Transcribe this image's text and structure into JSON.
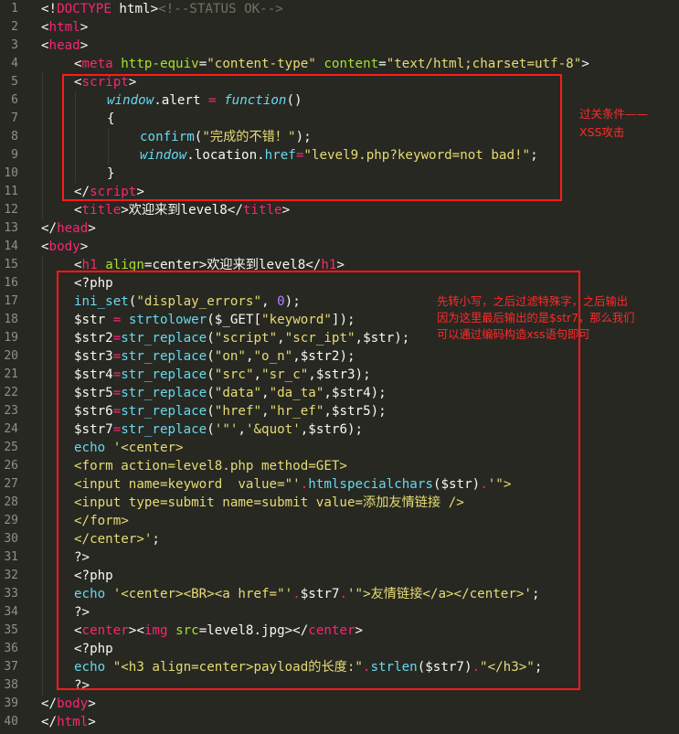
{
  "lines": [
    {
      "n": "1",
      "indent": 0,
      "tokens": [
        {
          "t": "<!",
          "c": "pl"
        },
        {
          "t": "DOCTYPE",
          "c": "tg"
        },
        {
          "t": " html>",
          "c": "pl"
        },
        {
          "t": "<!--STATUS OK-->",
          "c": "cm"
        }
      ]
    },
    {
      "n": "2",
      "indent": 0,
      "tokens": [
        {
          "t": "<",
          "c": "pl"
        },
        {
          "t": "html",
          "c": "tg"
        },
        {
          "t": ">",
          "c": "pl"
        }
      ]
    },
    {
      "n": "3",
      "indent": 0,
      "tokens": [
        {
          "t": "<",
          "c": "pl"
        },
        {
          "t": "head",
          "c": "tg"
        },
        {
          "t": ">",
          "c": "pl"
        }
      ]
    },
    {
      "n": "4",
      "indent": 1,
      "tokens": [
        {
          "t": "<",
          "c": "pl"
        },
        {
          "t": "meta",
          "c": "tg"
        },
        {
          "t": " ",
          "c": "pl"
        },
        {
          "t": "http-equiv",
          "c": "at"
        },
        {
          "t": "=",
          "c": "pl"
        },
        {
          "t": "\"content-type\"",
          "c": "st"
        },
        {
          "t": " ",
          "c": "pl"
        },
        {
          "t": "content",
          "c": "at"
        },
        {
          "t": "=",
          "c": "pl"
        },
        {
          "t": "\"text/html;charset=utf-8\"",
          "c": "st"
        },
        {
          "t": ">",
          "c": "pl"
        }
      ]
    },
    {
      "n": "5",
      "indent": 1,
      "tokens": [
        {
          "t": "<",
          "c": "pl"
        },
        {
          "t": "script",
          "c": "tg"
        },
        {
          "t": ">",
          "c": "pl"
        }
      ]
    },
    {
      "n": "6",
      "indent": 2,
      "tokens": [
        {
          "t": "window",
          "c": "fn"
        },
        {
          "t": ".alert ",
          "c": "pl"
        },
        {
          "t": "=",
          "c": "kw"
        },
        {
          "t": " ",
          "c": "pl"
        },
        {
          "t": "function",
          "c": "fn"
        },
        {
          "t": "()",
          "c": "pl"
        }
      ]
    },
    {
      "n": "7",
      "indent": 2,
      "tokens": [
        {
          "t": "{",
          "c": "pl"
        }
      ]
    },
    {
      "n": "8",
      "indent": 3,
      "tokens": [
        {
          "t": "confirm",
          "c": "bf"
        },
        {
          "t": "(",
          "c": "pl"
        },
        {
          "t": "\"完成的不错！\"",
          "c": "st"
        },
        {
          "t": ");",
          "c": "pl"
        }
      ]
    },
    {
      "n": "9",
      "indent": 3,
      "tokens": [
        {
          "t": "window",
          "c": "fn"
        },
        {
          "t": ".location.",
          "c": "pl"
        },
        {
          "t": "href",
          "c": "bf"
        },
        {
          "t": "=",
          "c": "kw"
        },
        {
          "t": "\"level9.php?keyword=not bad!\"",
          "c": "st"
        },
        {
          "t": ";",
          "c": "pl"
        }
      ]
    },
    {
      "n": "10",
      "indent": 2,
      "tokens": [
        {
          "t": "}",
          "c": "pl"
        }
      ]
    },
    {
      "n": "11",
      "indent": 1,
      "tokens": [
        {
          "t": "</",
          "c": "pl"
        },
        {
          "t": "script",
          "c": "tg"
        },
        {
          "t": ">",
          "c": "pl"
        }
      ]
    },
    {
      "n": "12",
      "indent": 1,
      "tokens": [
        {
          "t": "<",
          "c": "pl"
        },
        {
          "t": "title",
          "c": "tg"
        },
        {
          "t": ">欢迎来到level8</",
          "c": "pl"
        },
        {
          "t": "title",
          "c": "tg"
        },
        {
          "t": ">",
          "c": "pl"
        }
      ]
    },
    {
      "n": "13",
      "indent": 0,
      "tokens": [
        {
          "t": "</",
          "c": "pl"
        },
        {
          "t": "head",
          "c": "tg"
        },
        {
          "t": ">",
          "c": "pl"
        }
      ]
    },
    {
      "n": "14",
      "indent": 0,
      "tokens": [
        {
          "t": "<",
          "c": "pl"
        },
        {
          "t": "body",
          "c": "tg"
        },
        {
          "t": ">",
          "c": "pl"
        }
      ]
    },
    {
      "n": "15",
      "indent": 1,
      "tokens": [
        {
          "t": "<",
          "c": "pl"
        },
        {
          "t": "h1",
          "c": "tg"
        },
        {
          "t": " ",
          "c": "pl"
        },
        {
          "t": "align",
          "c": "at"
        },
        {
          "t": "=center>欢迎来到level8</",
          "c": "pl"
        },
        {
          "t": "h1",
          "c": "tg"
        },
        {
          "t": ">",
          "c": "pl"
        }
      ]
    },
    {
      "n": "16",
      "indent": 1,
      "tokens": [
        {
          "t": "<?php",
          "c": "pl"
        }
      ]
    },
    {
      "n": "17",
      "indent": 1,
      "tokens": [
        {
          "t": "ini_set",
          "c": "bf"
        },
        {
          "t": "(",
          "c": "pl"
        },
        {
          "t": "\"display_errors\"",
          "c": "st"
        },
        {
          "t": ", ",
          "c": "pl"
        },
        {
          "t": "0",
          "c": "nm"
        },
        {
          "t": ");",
          "c": "pl"
        }
      ]
    },
    {
      "n": "18",
      "indent": 1,
      "tokens": [
        {
          "t": "$str ",
          "c": "pl"
        },
        {
          "t": "=",
          "c": "kw"
        },
        {
          "t": " ",
          "c": "pl"
        },
        {
          "t": "strtolower",
          "c": "bf"
        },
        {
          "t": "($_GET[",
          "c": "pl"
        },
        {
          "t": "\"keyword\"",
          "c": "st"
        },
        {
          "t": "]);",
          "c": "pl"
        }
      ]
    },
    {
      "n": "19",
      "indent": 1,
      "tokens": [
        {
          "t": "$str2",
          "c": "pl"
        },
        {
          "t": "=",
          "c": "kw"
        },
        {
          "t": "str_replace",
          "c": "bf"
        },
        {
          "t": "(",
          "c": "pl"
        },
        {
          "t": "\"script\"",
          "c": "st"
        },
        {
          "t": ",",
          "c": "pl"
        },
        {
          "t": "\"scr_ipt\"",
          "c": "st"
        },
        {
          "t": ",$str);",
          "c": "pl"
        }
      ]
    },
    {
      "n": "20",
      "indent": 1,
      "tokens": [
        {
          "t": "$str3",
          "c": "pl"
        },
        {
          "t": "=",
          "c": "kw"
        },
        {
          "t": "str_replace",
          "c": "bf"
        },
        {
          "t": "(",
          "c": "pl"
        },
        {
          "t": "\"on\"",
          "c": "st"
        },
        {
          "t": ",",
          "c": "pl"
        },
        {
          "t": "\"o_n\"",
          "c": "st"
        },
        {
          "t": ",$str2);",
          "c": "pl"
        }
      ]
    },
    {
      "n": "21",
      "indent": 1,
      "tokens": [
        {
          "t": "$str4",
          "c": "pl"
        },
        {
          "t": "=",
          "c": "kw"
        },
        {
          "t": "str_replace",
          "c": "bf"
        },
        {
          "t": "(",
          "c": "pl"
        },
        {
          "t": "\"src\"",
          "c": "st"
        },
        {
          "t": ",",
          "c": "pl"
        },
        {
          "t": "\"sr_c\"",
          "c": "st"
        },
        {
          "t": ",$str3);",
          "c": "pl"
        }
      ]
    },
    {
      "n": "22",
      "indent": 1,
      "tokens": [
        {
          "t": "$str5",
          "c": "pl"
        },
        {
          "t": "=",
          "c": "kw"
        },
        {
          "t": "str_replace",
          "c": "bf"
        },
        {
          "t": "(",
          "c": "pl"
        },
        {
          "t": "\"data\"",
          "c": "st"
        },
        {
          "t": ",",
          "c": "pl"
        },
        {
          "t": "\"da_ta\"",
          "c": "st"
        },
        {
          "t": ",$str4);",
          "c": "pl"
        }
      ]
    },
    {
      "n": "23",
      "indent": 1,
      "tokens": [
        {
          "t": "$str6",
          "c": "pl"
        },
        {
          "t": "=",
          "c": "kw"
        },
        {
          "t": "str_replace",
          "c": "bf"
        },
        {
          "t": "(",
          "c": "pl"
        },
        {
          "t": "\"href\"",
          "c": "st"
        },
        {
          "t": ",",
          "c": "pl"
        },
        {
          "t": "\"hr_ef\"",
          "c": "st"
        },
        {
          "t": ",$str5);",
          "c": "pl"
        }
      ]
    },
    {
      "n": "24",
      "indent": 1,
      "tokens": [
        {
          "t": "$str7",
          "c": "pl"
        },
        {
          "t": "=",
          "c": "kw"
        },
        {
          "t": "str_replace",
          "c": "bf"
        },
        {
          "t": "(",
          "c": "pl"
        },
        {
          "t": "'\"'",
          "c": "st"
        },
        {
          "t": ",",
          "c": "pl"
        },
        {
          "t": "'&quot'",
          "c": "st"
        },
        {
          "t": ",$str6);",
          "c": "pl"
        }
      ]
    },
    {
      "n": "25",
      "indent": 1,
      "tokens": [
        {
          "t": "echo",
          "c": "bf"
        },
        {
          "t": " ",
          "c": "pl"
        },
        {
          "t": "'<center>",
          "c": "st"
        }
      ]
    },
    {
      "n": "26",
      "indent": 1,
      "tokens": [
        {
          "t": "<form action=level8.php method=GET>",
          "c": "st"
        }
      ]
    },
    {
      "n": "27",
      "indent": 1,
      "tokens": [
        {
          "t": "<input name=keyword  value=\"'",
          "c": "st"
        },
        {
          "t": ".",
          "c": "kw"
        },
        {
          "t": "htmlspecialchars",
          "c": "bf"
        },
        {
          "t": "($str)",
          "c": "pl"
        },
        {
          "t": ".",
          "c": "kw"
        },
        {
          "t": "'\">",
          "c": "st"
        }
      ]
    },
    {
      "n": "28",
      "indent": 1,
      "tokens": [
        {
          "t": "<input type=submit name=submit value=添加友情链接 />",
          "c": "st"
        }
      ]
    },
    {
      "n": "29",
      "indent": 1,
      "tokens": [
        {
          "t": "</form>",
          "c": "st"
        }
      ]
    },
    {
      "n": "30",
      "indent": 1,
      "tokens": [
        {
          "t": "</center>'",
          "c": "st"
        },
        {
          "t": ";",
          "c": "pl"
        }
      ]
    },
    {
      "n": "31",
      "indent": 1,
      "tokens": [
        {
          "t": "?>",
          "c": "pl"
        }
      ]
    },
    {
      "n": "32",
      "indent": 1,
      "tokens": [
        {
          "t": "<?php",
          "c": "pl"
        }
      ]
    },
    {
      "n": "33",
      "indent": 1,
      "tokens": [
        {
          "t": "echo",
          "c": "bf"
        },
        {
          "t": " ",
          "c": "pl"
        },
        {
          "t": "'<center><BR><a href=\"'",
          "c": "st"
        },
        {
          "t": ".",
          "c": "kw"
        },
        {
          "t": "$str7",
          "c": "pl"
        },
        {
          "t": ".",
          "c": "kw"
        },
        {
          "t": "'\">友情链接</a></center>'",
          "c": "st"
        },
        {
          "t": ";",
          "c": "pl"
        }
      ]
    },
    {
      "n": "34",
      "indent": 1,
      "tokens": [
        {
          "t": "?>",
          "c": "pl"
        }
      ]
    },
    {
      "n": "35",
      "indent": 1,
      "tokens": [
        {
          "t": "<",
          "c": "pl"
        },
        {
          "t": "center",
          "c": "tg"
        },
        {
          "t": "><",
          "c": "pl"
        },
        {
          "t": "img",
          "c": "tg"
        },
        {
          "t": " ",
          "c": "pl"
        },
        {
          "t": "src",
          "c": "at"
        },
        {
          "t": "=level8.jpg></",
          "c": "pl"
        },
        {
          "t": "center",
          "c": "tg"
        },
        {
          "t": ">",
          "c": "pl"
        }
      ]
    },
    {
      "n": "36",
      "indent": 1,
      "tokens": [
        {
          "t": "<?php",
          "c": "pl"
        }
      ]
    },
    {
      "n": "37",
      "indent": 1,
      "tokens": [
        {
          "t": "echo",
          "c": "bf"
        },
        {
          "t": " ",
          "c": "pl"
        },
        {
          "t": "\"<h3 align=center>payload的长度:\"",
          "c": "st"
        },
        {
          "t": ".",
          "c": "kw"
        },
        {
          "t": "strlen",
          "c": "bf"
        },
        {
          "t": "($str7)",
          "c": "pl"
        },
        {
          "t": ".",
          "c": "kw"
        },
        {
          "t": "\"</h3>\"",
          "c": "st"
        },
        {
          "t": ";",
          "c": "pl"
        }
      ]
    },
    {
      "n": "38",
      "indent": 1,
      "tokens": [
        {
          "t": "?>",
          "c": "pl"
        }
      ]
    },
    {
      "n": "39",
      "indent": 0,
      "tokens": [
        {
          "t": "</",
          "c": "pl"
        },
        {
          "t": "body",
          "c": "tg"
        },
        {
          "t": ">",
          "c": "pl"
        }
      ]
    },
    {
      "n": "40",
      "indent": 0,
      "tokens": [
        {
          "t": "</",
          "c": "pl"
        },
        {
          "t": "html",
          "c": "tg"
        },
        {
          "t": ">",
          "c": "pl"
        }
      ]
    }
  ],
  "annotations": {
    "note1": [
      "过关条件——",
      "XSS攻击"
    ],
    "note2": [
      "先转小写，之后过滤特殊字，之后输出",
      "因为这里最后输出的是$str7，那么我们",
      "可以通过编码构造xss语句即可"
    ]
  },
  "colors": {
    "background": "#272822",
    "annotation": "#ff2a2a",
    "tag": "#f92672",
    "attribute": "#a6e22e",
    "string": "#e6db74",
    "comment": "#75715e",
    "builtin": "#66d9ef",
    "number": "#ae81ff"
  }
}
